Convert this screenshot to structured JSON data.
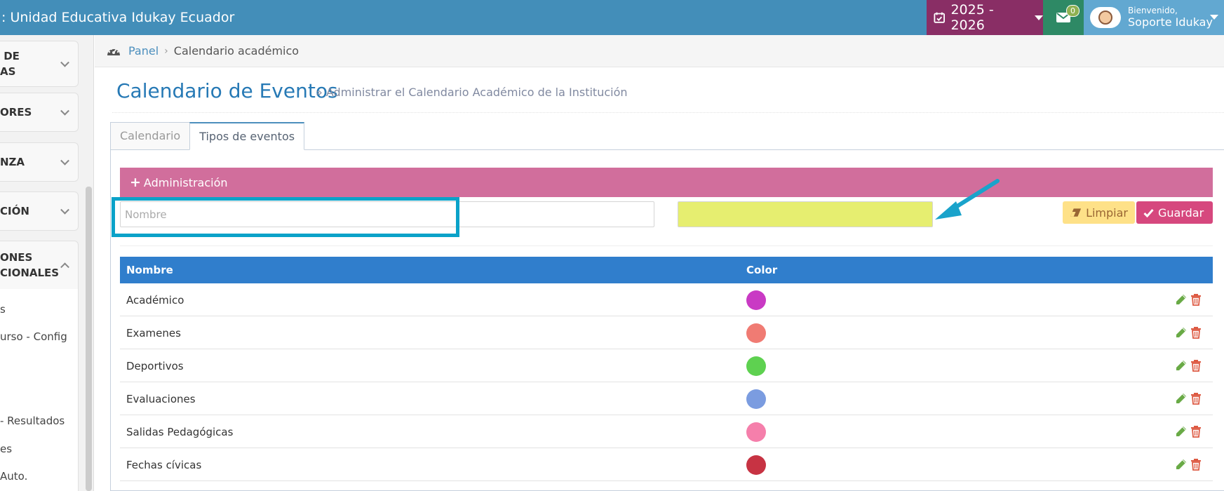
{
  "header": {
    "brand": ":  Unidad Educativa Idukay Ecuador",
    "year": "2025 - 2026",
    "messages_count": "0",
    "welcome": "Bienvenido,",
    "user_name": "Soporte Idukay"
  },
  "sidebar": {
    "items": [
      {
        "label": " DE\nAS",
        "expanded": false
      },
      {
        "label": "ORES",
        "expanded": false
      },
      {
        "label": "NZA",
        "expanded": false
      },
      {
        "label": "CIÓN",
        "expanded": false
      },
      {
        "label": "ONES\nCIONALES",
        "expanded": true
      }
    ],
    "submenu": [
      "s",
      "urso - Config",
      " - Resultados",
      "es",
      "Auto."
    ]
  },
  "breadcrumb": {
    "home": "Panel",
    "current": "Calendario académico"
  },
  "page": {
    "title": "Calendario de Eventos",
    "subtitle": "» Administrar el Calendario Académico de la Institución"
  },
  "tabs": [
    {
      "label": "Calendario",
      "active": false
    },
    {
      "label": "Tipos de eventos",
      "active": true
    }
  ],
  "admin": {
    "label": "Administración"
  },
  "form": {
    "name_placeholder": "Nombre",
    "color_value": "#e6ee70",
    "clear_label": "Limpiar",
    "save_label": "Guardar"
  },
  "table": {
    "headers": [
      "Nombre",
      "Color"
    ],
    "rows": [
      {
        "name": "Académico",
        "color": "#c93ac4"
      },
      {
        "name": "Examenes",
        "color": "#f07b73"
      },
      {
        "name": "Deportivos",
        "color": "#5ed150"
      },
      {
        "name": "Evaluaciones",
        "color": "#7b9ce0"
      },
      {
        "name": "Salidas Pedagógicas",
        "color": "#f57fab"
      },
      {
        "name": "Fechas cívicas",
        "color": "#c73343"
      }
    ]
  },
  "colors": {
    "topbar": "#438eb9",
    "year_box": "#892e65",
    "messages_box": "#2e8965",
    "user_box": "#62a8d1",
    "admin_bar": "#d16e9c",
    "table_header": "#307ecc",
    "highlight": "#0aa2c9"
  }
}
